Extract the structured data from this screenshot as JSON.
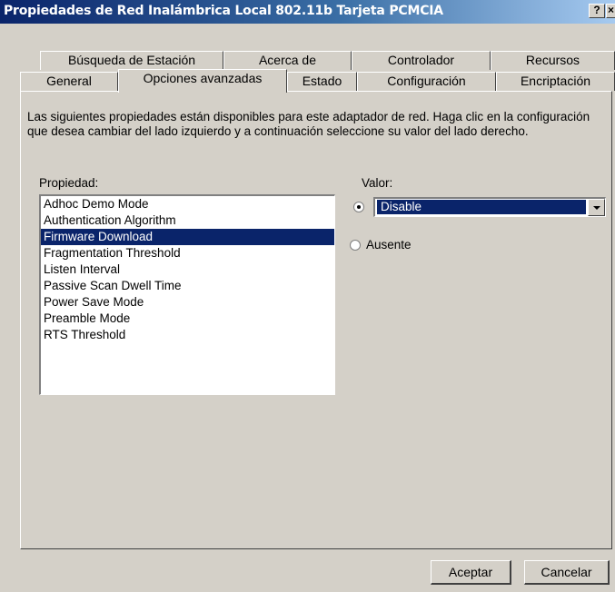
{
  "window": {
    "title": "Propiedades de Red Inalámbrica Local 802.11b Tarjeta PCMCIA",
    "help_button": "?",
    "close_button": "×"
  },
  "tabs_back": [
    "Búsqueda de Estación",
    "Acerca de",
    "Controlador",
    "Recursos"
  ],
  "tabs_front": [
    "General",
    "Opciones avanzadas",
    "Estado",
    "Configuración",
    "Encriptación"
  ],
  "active_tab": "Opciones avanzadas",
  "description": "Las siguientes propiedades están disponibles para este adaptador de red. Haga clic en la configuración que desea cambiar del lado izquierdo y a continuación seleccione su valor del lado derecho.",
  "property_label": "Propiedad:",
  "value_label": "Valor:",
  "properties": [
    "Adhoc Demo Mode",
    "Authentication Algorithm",
    "Firmware Download",
    "Fragmentation Threshold",
    "Listen Interval",
    "Passive Scan Dwell Time",
    "Power Save Mode",
    "Preamble Mode",
    "RTS Threshold"
  ],
  "selected_property": "Firmware Download",
  "value_select": "Disable",
  "absent_label": "Ausente",
  "buttons": {
    "accept": "Aceptar",
    "cancel": "Cancelar"
  },
  "colors": {
    "title_start": "#0a246a",
    "title_end": "#a6caf0",
    "selection": "#0a246a",
    "face": "#d4d0c8"
  }
}
